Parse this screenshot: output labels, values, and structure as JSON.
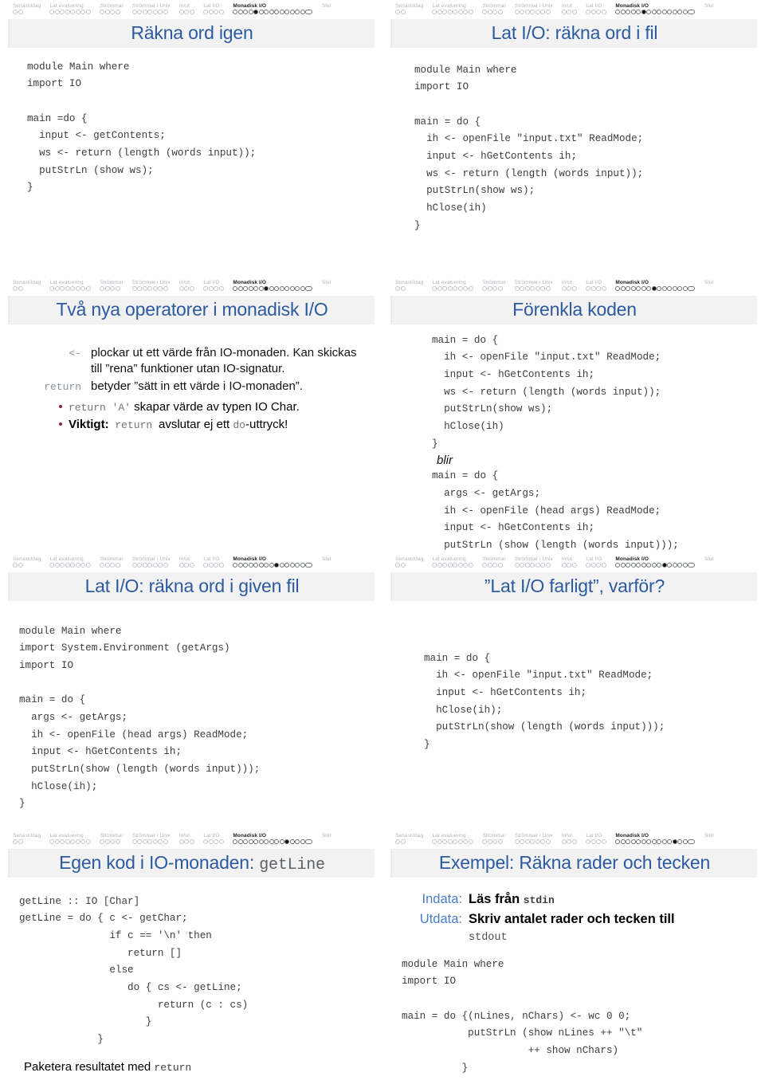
{
  "nav": {
    "sections": [
      {
        "label": "Senast/idag",
        "dots": 2,
        "active": false
      },
      {
        "label": "Lat evaluering",
        "dots": 8,
        "active": false
      },
      {
        "label": "Strömmar",
        "dots": 4,
        "active": false
      },
      {
        "label": "Strömmar i Unix",
        "dots": 7,
        "active": false
      },
      {
        "label": "In/ut",
        "dots": 3,
        "active": false
      },
      {
        "label": "Lat I/O",
        "dots": 4,
        "active": false
      },
      {
        "label": "Monadisk I/O",
        "dots": 12,
        "active": true
      },
      {
        "label": "Slut",
        "dots": 0,
        "active": false
      }
    ],
    "trailing_dots": 2,
    "trailing_wide": 1,
    "accent_color": "#2c5aa0",
    "dim_color": "#b0b5bb"
  },
  "slides": [
    {
      "title": "Räkna ord igen",
      "active_dot": 4,
      "code": "module Main where\nimport IO\n\nmain =do {\n  input <- getContents;\n  ws <- return (length (words input));\n  putStrLn (show ws);\n}"
    },
    {
      "title": "Lat I/O: räkna ord i fil",
      "active_dot": 5,
      "code": "module Main where\nimport IO\n\nmain = do {\n  ih <- openFile \"input.txt\" ReadMode;\n  input <- hGetContents ih;\n  ws <- return (length (words input));\n  putStrLn(show ws);\n  hClose(ih)\n}"
    },
    {
      "title": "Två nya operatorer i monadisk I/O",
      "active_dot": 6,
      "definitions": [
        {
          "term": "<-",
          "desc": "plockar ut ett värde från IO-monaden. Kan skickas till ”rena” funktioner utan IO-signatur."
        },
        {
          "term": "return",
          "desc": "betyder ”sätt in ett värde i IO-monaden”."
        }
      ],
      "bullets": [
        {
          "pre": "",
          "mono1": "return 'A'",
          "post": " skapar värde av typen IO Char."
        },
        {
          "bold": "Viktigt:",
          "mono1": " return ",
          "post": "avslutar ej ett ",
          "mono2": "do",
          "tail": "-uttryck!"
        }
      ]
    },
    {
      "title": "Förenkla koden",
      "active_dot": 7,
      "code_before": "main = do {\n  ih <- openFile \"input.txt\" ReadMode;\n  input <- hGetContents ih;\n  ws <- return (length (words input));\n  putStrLn(show ws);\n  hClose(ih)\n}",
      "connector": "blir",
      "code_after": "main = do {\n  args <- getArgs;\n  ih <- openFile (head args) ReadMode;\n  input <- hGetContents ih;\n  putStrLn (show (length (words input)));\n  hClose(ih);\n}"
    },
    {
      "title": "Lat I/O: räkna ord i given fil",
      "active_dot": 8,
      "code": "module Main where\nimport System.Environment (getArgs)\nimport IO\n\nmain = do {\n  args <- getArgs;\n  ih <- openFile (head args) ReadMode;\n  input <- hGetContents ih;\n  putStrLn(show (length (words input)));\n  hClose(ih);\n}"
    },
    {
      "title": "”Lat I/O farligt”, varför?",
      "active_dot": 9,
      "code": "main = do {\n  ih <- openFile \"input.txt\" ReadMode;\n  input <- hGetContents ih;\n  hClose(ih);\n  putStrLn(show (length (words input)));\n}"
    },
    {
      "title_plain": "Egen kod i IO-monaden: ",
      "title_mono": "getLine",
      "active_dot": 10,
      "code": "getLine :: IO [Char]\ngetLine = do { c <- getChar;\n               if c == '\\n' then\n                  return []\n               else\n                  do { cs <- getLine;\n                       return (c : cs)\n                     }\n             }",
      "footer_pre": "Paketera resultatet med ",
      "footer_mono": "return"
    },
    {
      "title": "Exempel: Räkna rader och tecken",
      "active_dot": 11,
      "io": [
        {
          "term": "Indata:",
          "desc": "Läs från ",
          "mono": "stdin",
          "cont": ""
        },
        {
          "term": "Utdata:",
          "desc": "Skriv antalet rader och tecken till",
          "mono": "",
          "cont": "stdout"
        }
      ],
      "code": "module Main where\nimport IO\n\nmain = do {(nLines, nChars) <- wc 0 0;\n           putStrLn (show nLines ++ \"\\t\"\n                     ++ show nChars)\n          }"
    }
  ]
}
